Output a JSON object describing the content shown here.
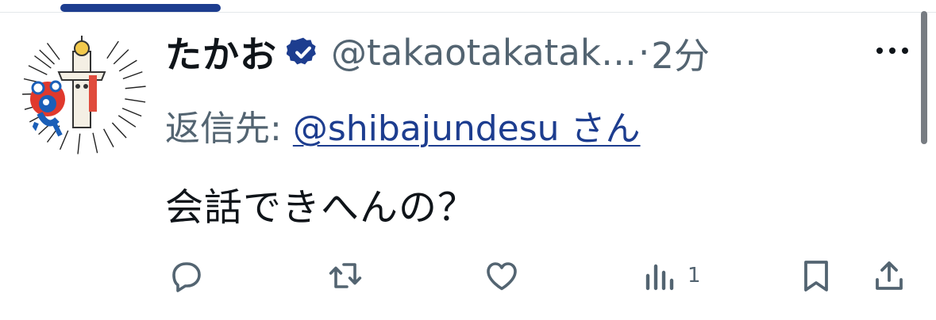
{
  "tweet": {
    "display_name": "たかお",
    "handle": "@takaotakatak…",
    "separator": "·",
    "time": "2分",
    "reply_label": "返信先:",
    "reply_to": "@shibajundesu さん",
    "text": "会話できへんの？",
    "views_count": "1"
  },
  "icons": {
    "verified": "verified-badge-icon",
    "more": "more-options-icon",
    "reply": "reply-icon",
    "retweet": "retweet-icon",
    "like": "like-icon",
    "views": "views-icon",
    "bookmark": "bookmark-icon",
    "share": "share-icon"
  },
  "colors": {
    "accent": "#1d3d8f",
    "text_primary": "#0f1419",
    "text_secondary": "#536471",
    "icon": "#536471"
  }
}
